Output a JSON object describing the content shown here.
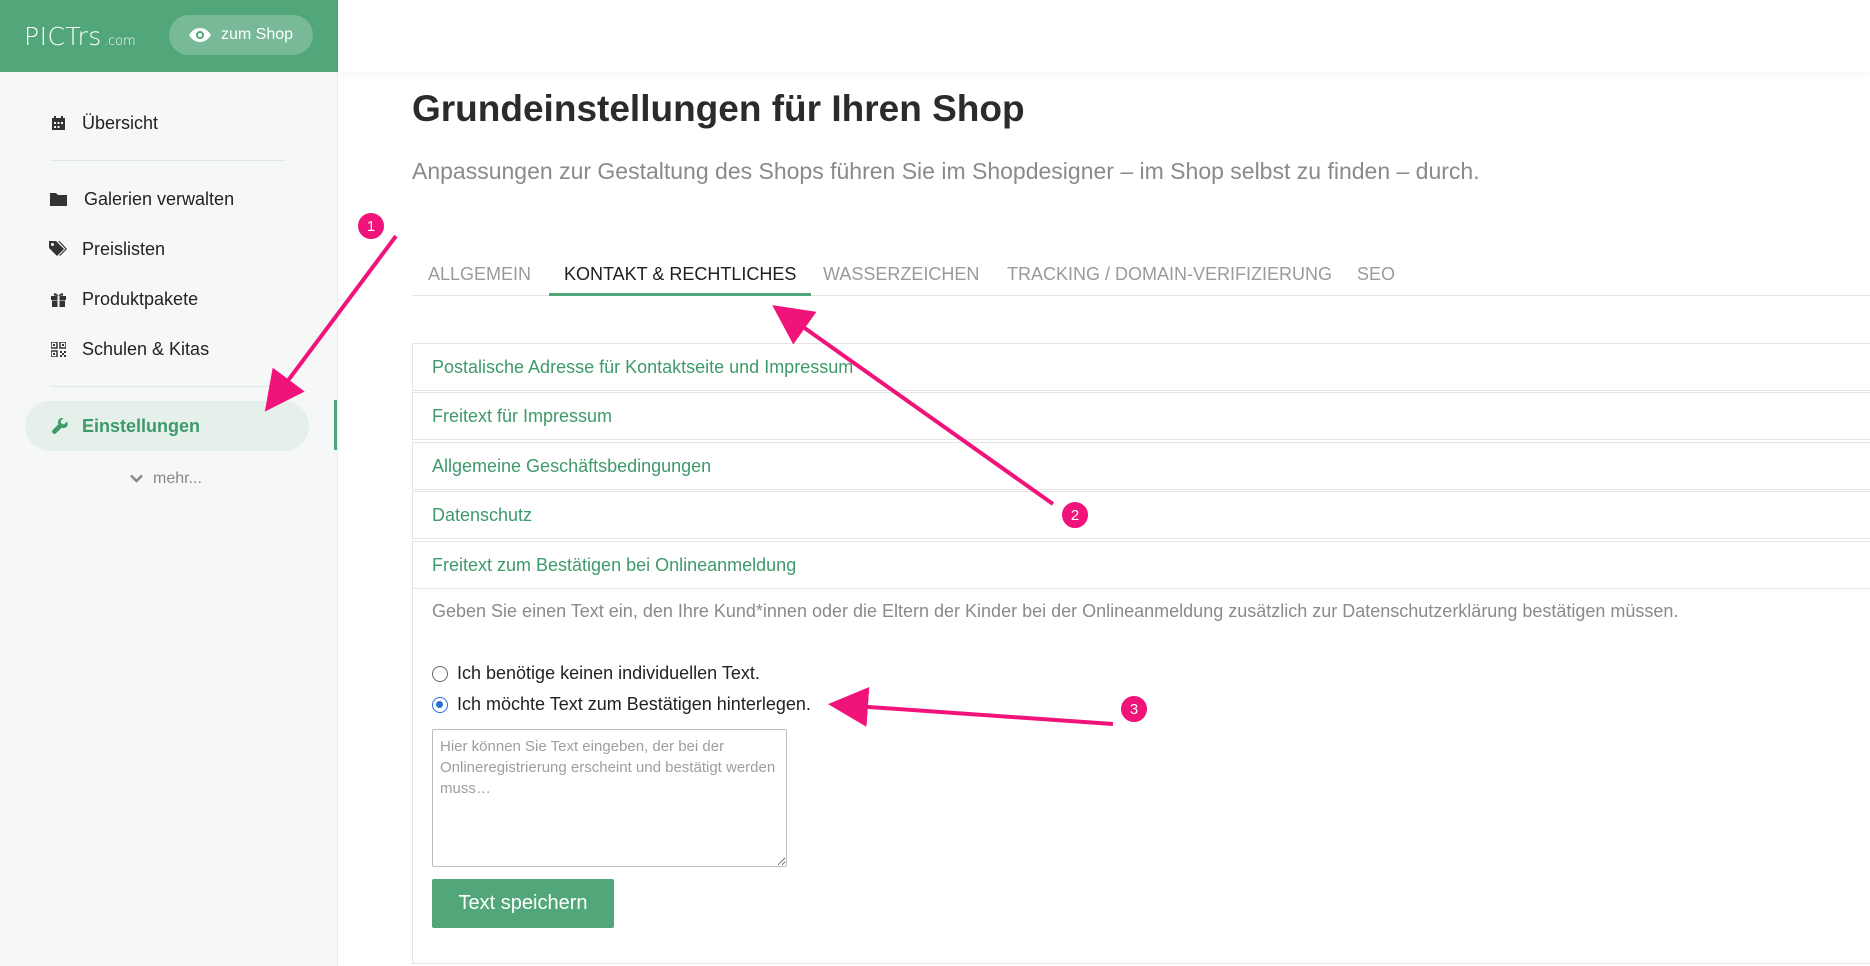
{
  "brand": {
    "name": "PICTrs",
    "suffix": ".com",
    "shop_button": "zum Shop"
  },
  "sidebar": {
    "items": [
      {
        "label": "Übersicht",
        "icon": "calendar-icon"
      },
      {
        "label": "Galerien verwalten",
        "icon": "folder-icon"
      },
      {
        "label": "Preislisten",
        "icon": "tags-icon"
      },
      {
        "label": "Produktpakete",
        "icon": "gift-icon"
      },
      {
        "label": "Schulen & Kitas",
        "icon": "qrcode-icon"
      }
    ],
    "active": {
      "label": "Einstellungen",
      "icon": "wrench-icon"
    },
    "more": "mehr..."
  },
  "page": {
    "title": "Grundeinstellungen für Ihren Shop",
    "subtitle": "Anpassungen zur Gestaltung des Shops führen Sie im Shopdesigner – im Shop selbst zu finden – durch."
  },
  "tabs": [
    {
      "label": "ALLGEMEIN"
    },
    {
      "label": "KONTAKT & RECHTLICHES",
      "active": true
    },
    {
      "label": "WASSERZEICHEN"
    },
    {
      "label": "TRACKING / DOMAIN-VERIFIZIERUNG"
    },
    {
      "label": "SEO"
    }
  ],
  "sections": [
    "Postalische Adresse für Kontaktseite und Impressum",
    "Freitext für Impressum",
    "Allgemeine Geschäftsbedingungen",
    "Datenschutz",
    "Freitext zum Bestätigen bei Onlineanmeldung"
  ],
  "confirm_text": {
    "description": "Geben Sie einen Text ein, den Ihre Kund*innen oder die Eltern der Kinder bei der Onlineanmeldung zusätzlich zur Datenschutzerklärung bestätigen müssen.",
    "option_none": "Ich benötige keinen individuellen Text.",
    "option_custom": "Ich möchte Text zum Bestätigen hinterlegen.",
    "selected": "option_custom",
    "placeholder": "Hier können Sie Text eingeben, der bei der Onlineregistrierung erscheint und bestätigt werden muss…",
    "save_label": "Text speichern"
  },
  "annotations": {
    "badge_1": "1",
    "badge_2": "2",
    "badge_3": "3",
    "color": "#f0137a"
  },
  "colors": {
    "brand_green": "#52a77a",
    "link_green": "#3e9a6a"
  }
}
